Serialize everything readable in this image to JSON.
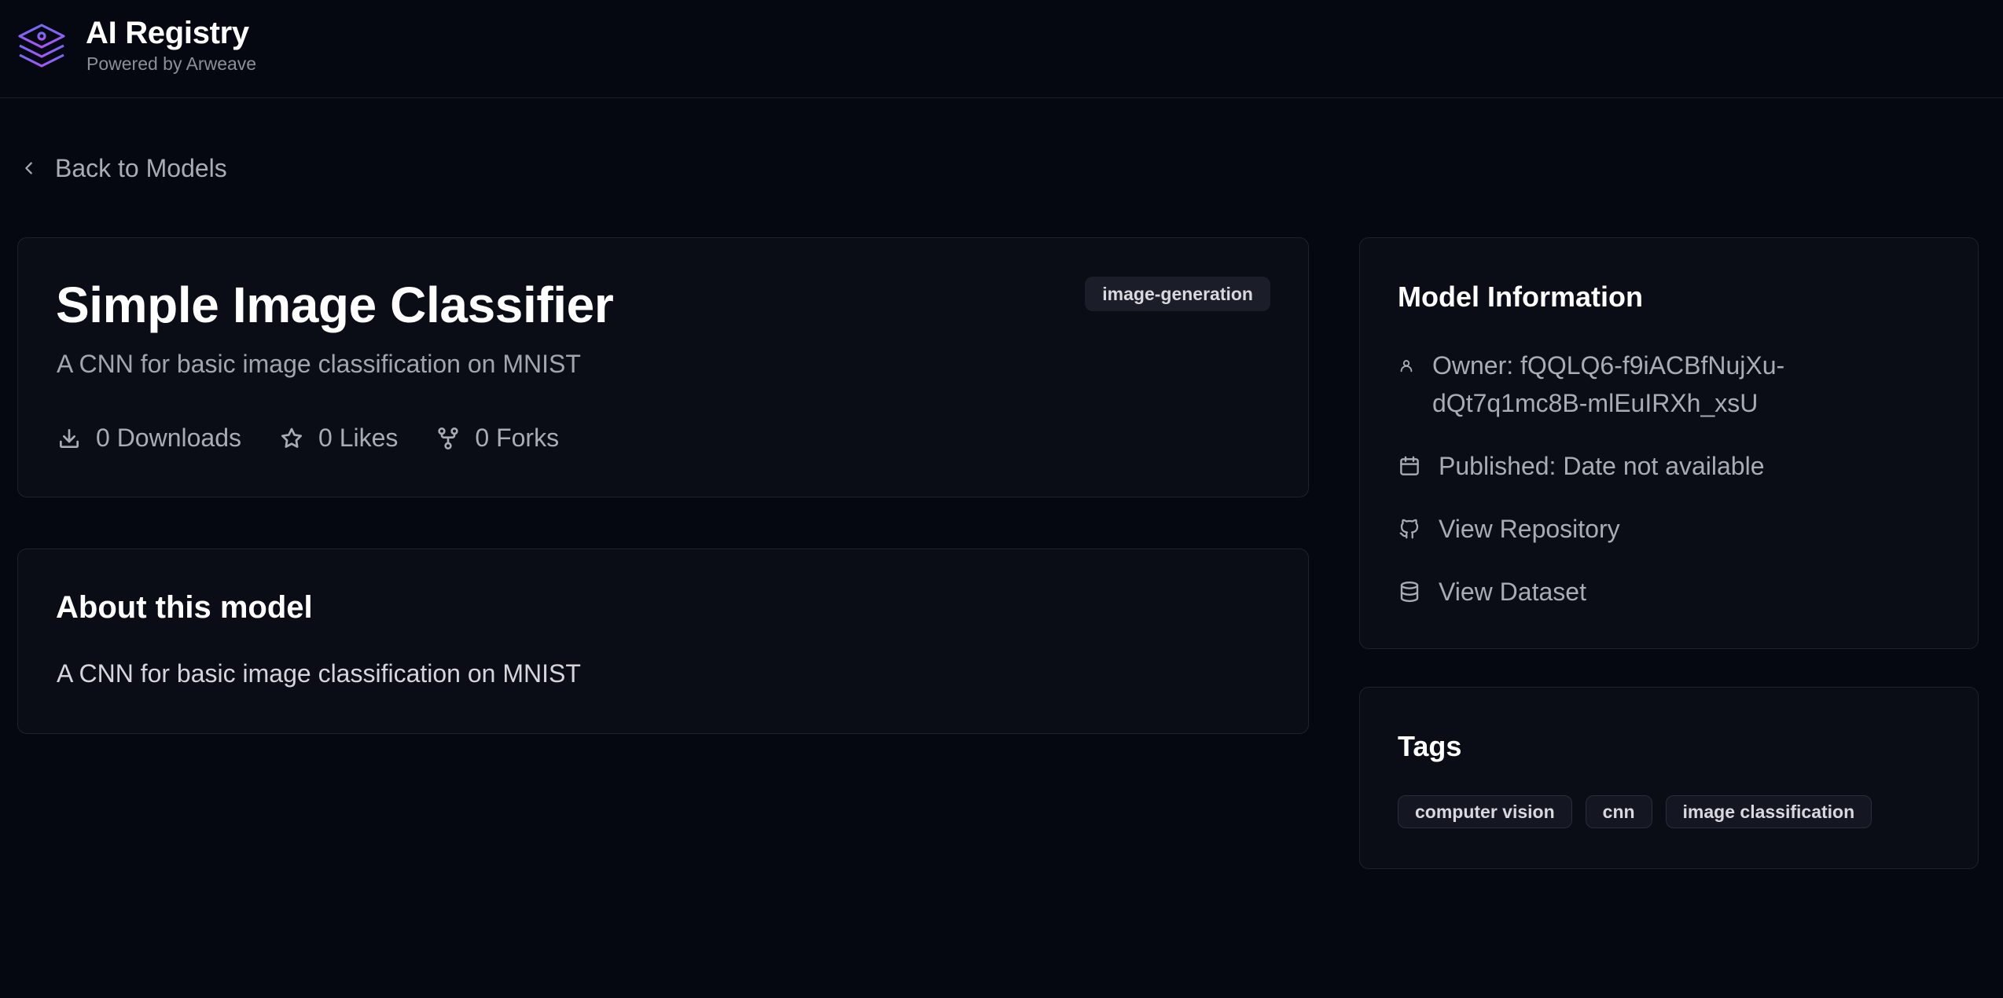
{
  "brand": {
    "title": "AI Registry",
    "subtitle": "Powered by Arweave",
    "accent_color": "#8b5cf6"
  },
  "nav": {
    "back_label": "Back to Models"
  },
  "model": {
    "title": "Simple Image Classifier",
    "description": "A CNN for basic image classification on MNIST",
    "category": "image-generation",
    "stats": {
      "downloads": "0 Downloads",
      "likes": "0 Likes",
      "forks": "0 Forks"
    }
  },
  "about": {
    "heading": "About this model",
    "text": "A CNN for basic image classification on MNIST"
  },
  "info": {
    "heading": "Model Information",
    "owner": "Owner: fQQLQ6-f9iACBfNujXu-dQt7q1mc8B-mlEuIRXh_xsU",
    "published": "Published: Date not available",
    "repository": "View Repository",
    "dataset": "View Dataset"
  },
  "tags": {
    "heading": "Tags",
    "items": [
      "computer vision",
      "cnn",
      "image classification"
    ]
  },
  "icons": {
    "logo": "layers-icon",
    "back": "chevron-left-icon",
    "downloads": "download-icon",
    "likes": "star-icon",
    "forks": "git-fork-icon",
    "owner": "user-icon",
    "published": "calendar-icon",
    "repository": "github-icon",
    "dataset": "database-icon"
  }
}
